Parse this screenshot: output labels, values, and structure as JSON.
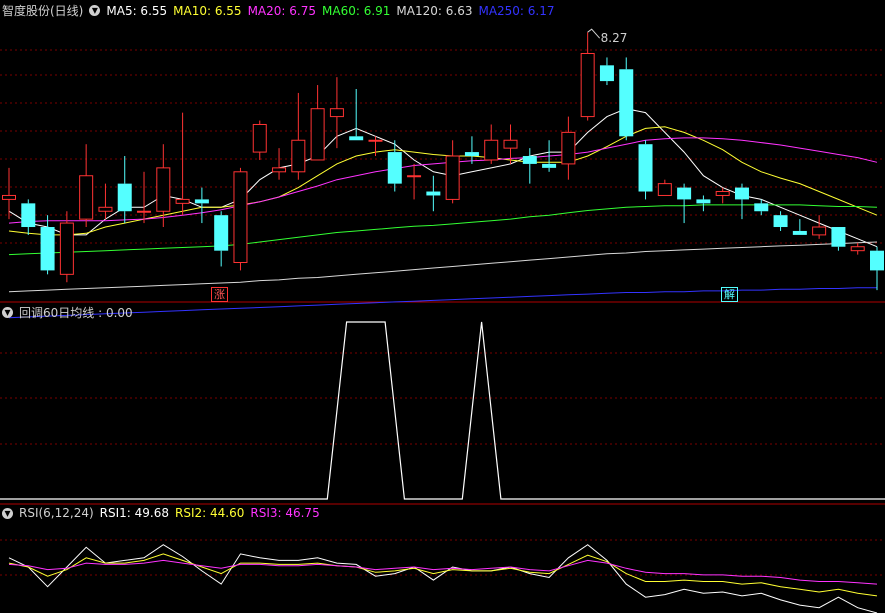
{
  "header": {
    "title": "智度股份(日线)",
    "ma": [
      {
        "label": "MA5: 6.55",
        "color": "#ffffff"
      },
      {
        "label": "MA10: 6.55",
        "color": "#ffff33"
      },
      {
        "label": "MA20: 6.75",
        "color": "#ff33ff"
      },
      {
        "label": "MA60: 6.91",
        "color": "#33ff33"
      },
      {
        "label": "MA120: 6.63",
        "color": "#d8d8d8"
      },
      {
        "label": "MA250: 6.17",
        "color": "#3333ff"
      }
    ]
  },
  "indicator": {
    "title": "回调60日均线 : 0.00"
  },
  "rsi": {
    "title": "RSI(6,12,24)",
    "items": [
      {
        "label": "RSI1: 49.68",
        "color": "#ffffff"
      },
      {
        "label": "RSI2: 44.60",
        "color": "#ffff33"
      },
      {
        "label": "RSI3: 46.75",
        "color": "#ff33ff"
      }
    ]
  },
  "tags": {
    "zhang": "涨",
    "jie": "解"
  },
  "colors": {
    "up": "#ff3333",
    "down": "#54ffff",
    "grid": "#7a0000",
    "divider": "#b00000"
  },
  "chart_data": [
    {
      "type": "candlestick",
      "ylim": [
        4.9,
        8.45
      ],
      "high_label": "8.27",
      "candles": [
        [
          6.15,
          6.2,
          6.55,
          5.9
        ],
        [
          6.1,
          5.8,
          6.15,
          5.7
        ],
        [
          5.8,
          5.25,
          5.95,
          5.2
        ],
        [
          5.2,
          5.85,
          6.0,
          5.1
        ],
        [
          5.9,
          6.45,
          6.85,
          5.8
        ],
        [
          6.0,
          6.05,
          6.35,
          5.9
        ],
        [
          6.35,
          6.0,
          6.7,
          5.85
        ],
        [
          6.0,
          6.0,
          6.5,
          5.85
        ],
        [
          6.0,
          6.55,
          6.85,
          5.8
        ],
        [
          6.1,
          6.15,
          7.25,
          5.95
        ],
        [
          6.15,
          6.1,
          6.3,
          5.85
        ],
        [
          5.95,
          5.5,
          6.0,
          5.3
        ],
        [
          5.35,
          6.5,
          6.55,
          5.25
        ],
        [
          6.75,
          7.1,
          7.15,
          6.65
        ],
        [
          6.5,
          6.55,
          6.8,
          6.4
        ],
        [
          6.5,
          6.9,
          7.5,
          6.4
        ],
        [
          6.65,
          7.3,
          7.6,
          6.65
        ],
        [
          7.2,
          7.3,
          7.7,
          6.8
        ],
        [
          6.95,
          6.9,
          7.55,
          6.9
        ],
        [
          6.9,
          6.9,
          6.95,
          6.7
        ],
        [
          6.75,
          6.35,
          6.9,
          6.25
        ],
        [
          6.45,
          6.45,
          6.6,
          6.15
        ],
        [
          6.25,
          6.2,
          6.45,
          6.0
        ],
        [
          6.15,
          6.7,
          6.9,
          6.1
        ],
        [
          6.75,
          6.7,
          6.95,
          6.6
        ],
        [
          6.65,
          6.9,
          7.1,
          6.6
        ],
        [
          6.8,
          6.9,
          7.1,
          6.6
        ],
        [
          6.7,
          6.6,
          6.8,
          6.35
        ],
        [
          6.6,
          6.55,
          6.9,
          6.5
        ],
        [
          6.6,
          7.0,
          7.2,
          6.4
        ],
        [
          7.2,
          8.0,
          8.27,
          7.15
        ],
        [
          7.85,
          7.65,
          7.95,
          7.6
        ],
        [
          7.8,
          6.95,
          7.95,
          6.9
        ],
        [
          6.85,
          6.25,
          6.9,
          6.15
        ],
        [
          6.2,
          6.35,
          6.4,
          6.2
        ],
        [
          6.3,
          6.15,
          6.35,
          5.85
        ],
        [
          6.15,
          6.1,
          6.2,
          6.0
        ],
        [
          6.2,
          6.25,
          6.3,
          6.1
        ],
        [
          6.3,
          6.15,
          6.35,
          5.9
        ],
        [
          6.1,
          6.0,
          6.15,
          5.95
        ],
        [
          5.95,
          5.8,
          6.0,
          5.75
        ],
        [
          5.75,
          5.7,
          5.9,
          5.7
        ],
        [
          5.7,
          5.8,
          5.95,
          5.65
        ],
        [
          5.8,
          5.55,
          5.8,
          5.5
        ],
        [
          5.5,
          5.55,
          5.6,
          5.45
        ],
        [
          5.5,
          5.25,
          5.55,
          5.0
        ]
      ],
      "series": [
        {
          "name": "MA5",
          "color": "#ffffff",
          "values": [
            6.0,
            5.85,
            5.8,
            5.7,
            5.7,
            5.9,
            6.05,
            6.05,
            6.2,
            6.15,
            6.05,
            6.05,
            6.15,
            6.4,
            6.55,
            6.6,
            6.7,
            6.95,
            7.05,
            6.95,
            6.85,
            6.65,
            6.5,
            6.45,
            6.5,
            6.55,
            6.6,
            6.7,
            6.75,
            6.75,
            7.0,
            7.2,
            7.3,
            7.25,
            7.0,
            6.75,
            6.45,
            6.3,
            6.2,
            6.15,
            6.05,
            5.95,
            5.85,
            5.75,
            5.65,
            5.55
          ]
        },
        {
          "name": "MA10",
          "color": "#ffff33",
          "values": [
            5.75,
            5.72,
            5.7,
            5.7,
            5.72,
            5.8,
            5.85,
            5.9,
            5.95,
            6.0,
            6.05,
            6.05,
            6.08,
            6.12,
            6.18,
            6.3,
            6.45,
            6.6,
            6.7,
            6.75,
            6.78,
            6.75,
            6.72,
            6.7,
            6.7,
            6.68,
            6.65,
            6.62,
            6.62,
            6.62,
            6.7,
            6.82,
            6.95,
            7.05,
            7.07,
            7.0,
            6.9,
            6.78,
            6.62,
            6.5,
            6.42,
            6.35,
            6.25,
            6.15,
            6.05,
            5.95
          ]
        },
        {
          "name": "MA20",
          "color": "#ff33ff",
          "values": [
            5.85,
            5.87,
            5.88,
            5.88,
            5.88,
            5.88,
            5.89,
            5.9,
            5.92,
            5.95,
            5.98,
            6.02,
            6.07,
            6.12,
            6.18,
            6.25,
            6.32,
            6.4,
            6.45,
            6.5,
            6.54,
            6.58,
            6.6,
            6.62,
            6.64,
            6.65,
            6.67,
            6.68,
            6.7,
            6.72,
            6.75,
            6.8,
            6.85,
            6.9,
            6.92,
            6.93,
            6.93,
            6.92,
            6.9,
            6.87,
            6.84,
            6.8,
            6.76,
            6.72,
            6.68,
            6.62
          ]
        },
        {
          "name": "MA60",
          "color": "#33ff33",
          "values": [
            5.45,
            5.46,
            5.47,
            5.48,
            5.49,
            5.5,
            5.51,
            5.52,
            5.53,
            5.54,
            5.55,
            5.56,
            5.58,
            5.61,
            5.64,
            5.67,
            5.7,
            5.73,
            5.75,
            5.77,
            5.79,
            5.81,
            5.82,
            5.84,
            5.86,
            5.88,
            5.9,
            5.93,
            5.95,
            5.98,
            6.01,
            6.03,
            6.05,
            6.06,
            6.07,
            6.07,
            6.08,
            6.08,
            6.08,
            6.08,
            6.08,
            6.08,
            6.07,
            6.06,
            6.06,
            6.05
          ]
        },
        {
          "name": "MA120",
          "color": "#d8d8d8",
          "values": [
            4.98,
            4.99,
            5.0,
            5.01,
            5.02,
            5.03,
            5.04,
            5.05,
            5.06,
            5.07,
            5.08,
            5.09,
            5.1,
            5.12,
            5.13,
            5.15,
            5.16,
            5.18,
            5.2,
            5.22,
            5.24,
            5.26,
            5.28,
            5.3,
            5.32,
            5.34,
            5.36,
            5.38,
            5.4,
            5.42,
            5.44,
            5.46,
            5.47,
            5.49,
            5.5,
            5.51,
            5.52,
            5.53,
            5.54,
            5.55,
            5.56,
            5.57,
            5.58,
            5.59,
            5.6,
            5.61
          ]
        },
        {
          "name": "MA250",
          "color": "#3333ff",
          "values": [
            4.65,
            4.66,
            4.67,
            4.68,
            4.69,
            4.7,
            4.71,
            4.72,
            4.73,
            4.74,
            4.75,
            4.76,
            4.77,
            4.78,
            4.79,
            4.8,
            4.81,
            4.82,
            4.83,
            4.84,
            4.85,
            4.86,
            4.87,
            4.88,
            4.89,
            4.9,
            4.91,
            4.92,
            4.93,
            4.94,
            4.95,
            4.96,
            4.97,
            4.97,
            4.98,
            4.98,
            4.99,
            4.99,
            5.0,
            5.0,
            5.01,
            5.01,
            5.02,
            5.02,
            5.03,
            5.03
          ]
        }
      ]
    },
    {
      "type": "line",
      "ylim": [
        0,
        1
      ],
      "x": [
        0,
        16.5,
        17.5,
        19.5,
        20.5,
        23.5,
        24.5,
        25.5
      ],
      "series": [
        {
          "name": "回调60日均线",
          "color": "#ffffff",
          "values": [
            0,
            0,
            1,
            1,
            0,
            0,
            1,
            0
          ]
        }
      ]
    },
    {
      "type": "line",
      "ylim": [
        20,
        90
      ],
      "series": [
        {
          "name": "RSI1",
          "color": "#ffffff",
          "values": [
            62,
            55,
            40,
            55,
            70,
            58,
            60,
            62,
            72,
            63,
            52,
            42,
            65,
            62,
            60,
            60,
            62,
            58,
            57,
            48,
            50,
            55,
            45,
            55,
            52,
            52,
            55,
            50,
            47,
            62,
            72,
            60,
            42,
            32,
            34,
            38,
            35,
            36,
            33,
            35,
            30,
            26,
            24,
            32,
            24,
            20
          ]
        },
        {
          "name": "RSI2",
          "color": "#ffff33",
          "values": [
            58,
            55,
            48,
            53,
            62,
            58,
            58,
            60,
            65,
            60,
            55,
            50,
            58,
            58,
            57,
            57,
            58,
            56,
            55,
            51,
            52,
            54,
            50,
            53,
            52,
            52,
            54,
            51,
            50,
            57,
            64,
            59,
            50,
            44,
            44,
            45,
            44,
            44,
            42,
            43,
            40,
            38,
            36,
            38,
            35,
            33
          ]
        },
        {
          "name": "RSI3",
          "color": "#ff33ff",
          "values": [
            57,
            56,
            53,
            54,
            58,
            57,
            57,
            58,
            60,
            58,
            56,
            54,
            57,
            57,
            56,
            56,
            57,
            56,
            55,
            53,
            54,
            55,
            53,
            54,
            53,
            54,
            55,
            53,
            52,
            56,
            60,
            58,
            54,
            51,
            50,
            50,
            49,
            49,
            48,
            48,
            47,
            45,
            44,
            44,
            43,
            42
          ]
        }
      ]
    }
  ]
}
